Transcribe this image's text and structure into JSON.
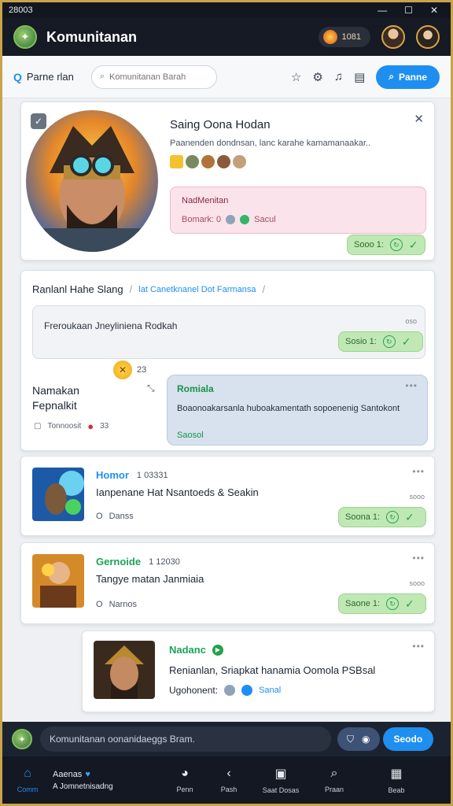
{
  "window": {
    "title": "28003",
    "controls": [
      "—",
      "☐",
      "✕"
    ]
  },
  "header": {
    "app_title": "Komunitanan",
    "coins": "1081"
  },
  "toolbar": {
    "page_title": "Parne rlan",
    "search_placeholder": "Komunitanan Barah",
    "primary_label": "Panne"
  },
  "profile_card": {
    "name": "Saing Oona Hodan",
    "description": "Paanenden dondnsan, lanc karahe kamamanaakar..",
    "bubble_title": "NadMenitan",
    "bubble_meta": "Bomark: 0",
    "bubble_count": "Sacul",
    "ok_label": "Sooo 1:"
  },
  "thread": {
    "breadcrumb_a": "Ranlanl Hahe Slang",
    "breadcrumb_b": "lat Canetknanel Dot Farmansa",
    "quote": "Freroukaan Jneyliniena Rodkah",
    "quote_time": "oso",
    "ok_label": "Sosio 1:",
    "emoji_count": "23",
    "author_line1": "Namakan",
    "author_line2": "Fepnalkit",
    "author_meta": "Tonnoosit",
    "author_count": "33",
    "reply_title": "Romiala",
    "reply_body": "Boaonoakarsanla huboakamentath sopoenenig Santokont",
    "reply_tag": "Saosol"
  },
  "posts": [
    {
      "title": "Homor",
      "meta": "1 03331",
      "text": "Ianpenane Hat Nsantoeds & Seakin",
      "sub": "Danss",
      "ok_label": "Soona 1:",
      "time": "sooo"
    },
    {
      "title": "Gernoide",
      "meta": "1 12030",
      "text": "Tangye matan Janmiaia",
      "sub": "Narnos",
      "ok_label": "Saone 1:",
      "time": "sooo"
    },
    {
      "title": "Nadanc",
      "meta": "",
      "text": "Renianlan, Sriapkat hanamia Oomola PSBsal",
      "sub": "Ugohonent:",
      "extra": "Sanal"
    }
  ],
  "composer": {
    "placeholder": "Komunitanan oonanidaeggs Bram.",
    "send_label": "Seodo"
  },
  "nav": [
    {
      "label": "Comm",
      "icon": "home-icon"
    },
    {
      "label": "Aaenas",
      "icon": "heart-icon"
    },
    {
      "label": "Penn",
      "icon": "chat-icon"
    },
    {
      "label": "Pash",
      "icon": "back-icon"
    },
    {
      "label": "Saat Dosas",
      "icon": "board-icon"
    },
    {
      "label": "Praan",
      "icon": "search-icon"
    },
    {
      "label": "Beab",
      "icon": "grid-icon"
    }
  ],
  "nav_community_line1": "Aaenas",
  "nav_community_line2": "A Jomnetnisadng",
  "colors": {
    "accent": "#1f8ef1",
    "ok": "#27a04a",
    "header": "#151a24",
    "brand_green": "#1aa35a"
  }
}
